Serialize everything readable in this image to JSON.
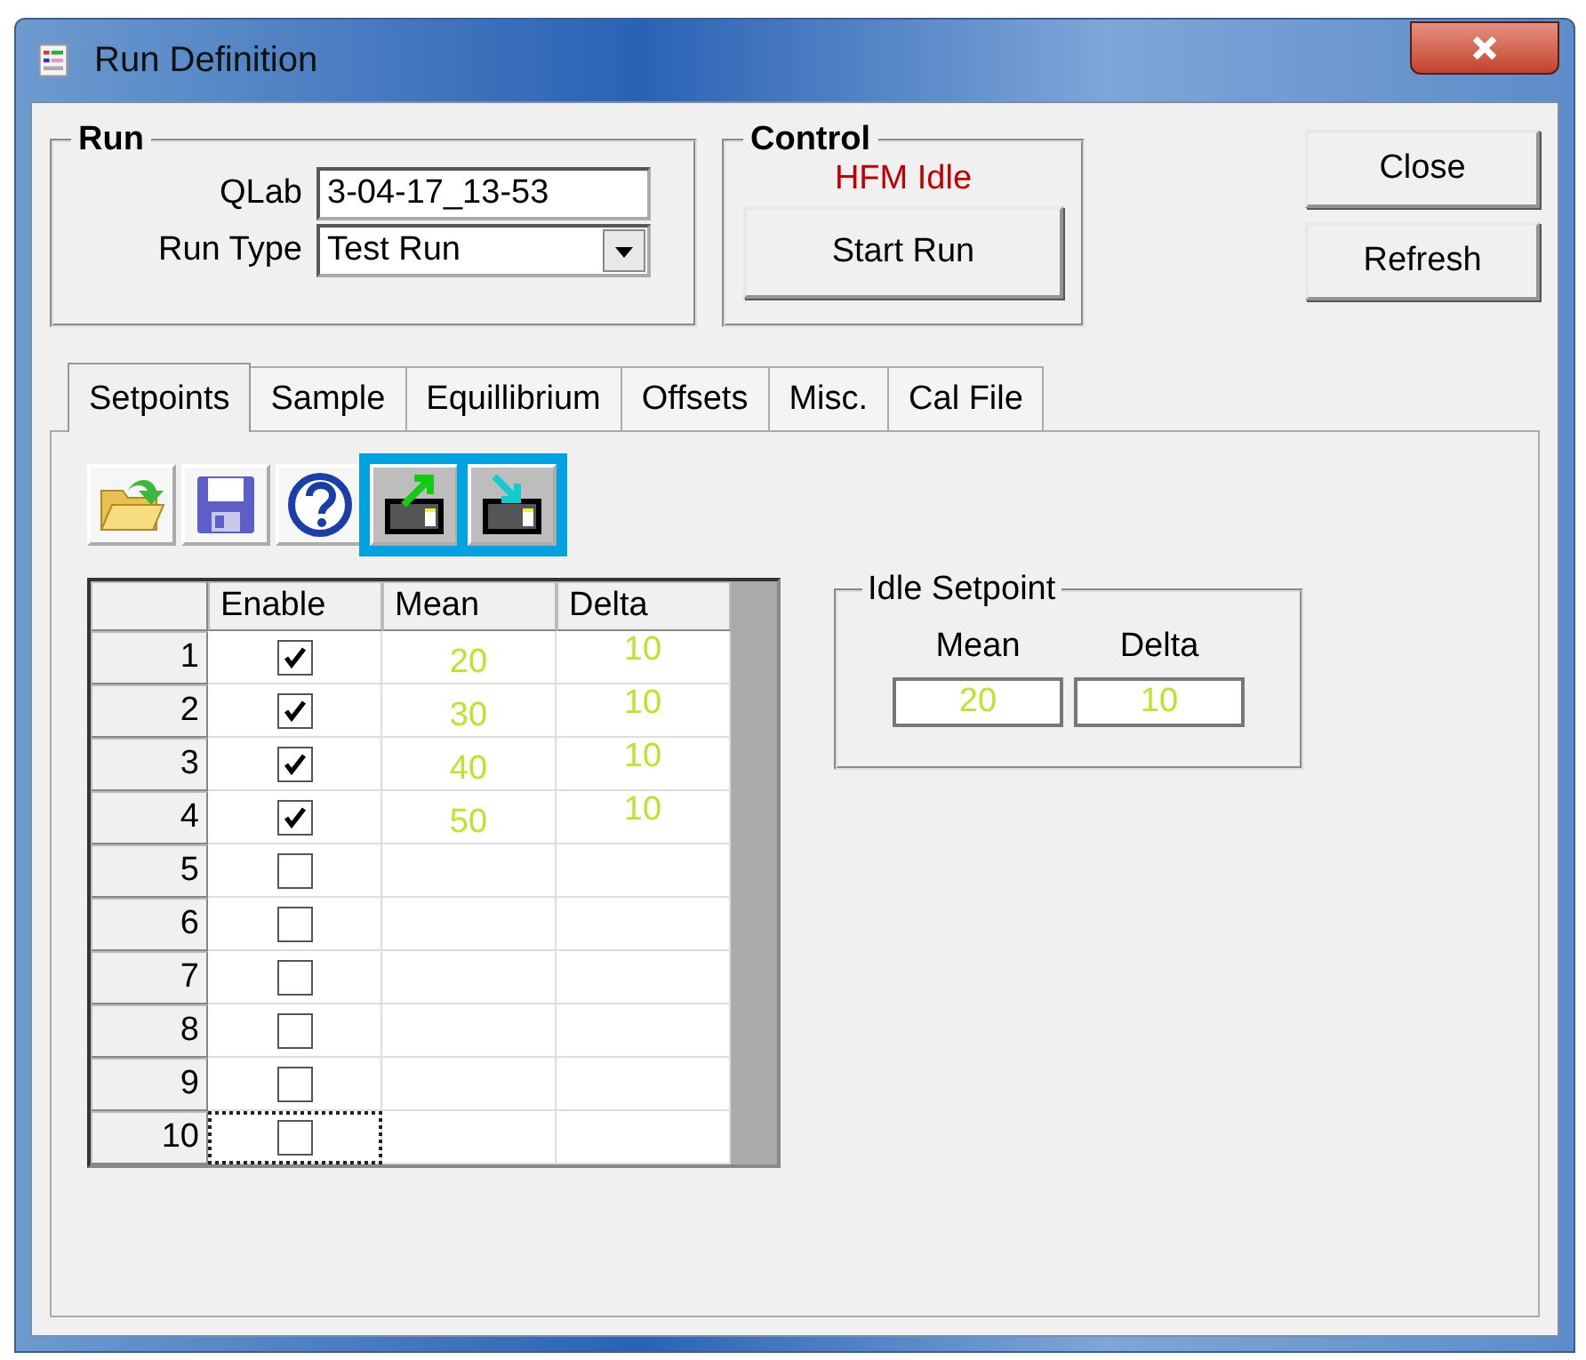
{
  "window": {
    "title": "Run Definition"
  },
  "run_group": {
    "title": "Run",
    "qlab_label": "QLab",
    "qlab_value": "3-04-17_13-53",
    "run_type_label": "Run Type",
    "run_type_value": "Test Run"
  },
  "control_group": {
    "title": "Control",
    "status": "HFM Idle",
    "start_button": "Start Run"
  },
  "side_buttons": [
    "Close",
    "Refresh"
  ],
  "tabs": [
    {
      "label": "Setpoints",
      "selected": true
    },
    {
      "label": "Sample",
      "selected": false
    },
    {
      "label": "Equillibrium",
      "selected": false
    },
    {
      "label": "Offsets",
      "selected": false
    },
    {
      "label": "Misc.",
      "selected": false
    },
    {
      "label": "Cal File",
      "selected": false
    }
  ],
  "toolbar": [
    {
      "kind": "open",
      "highlighted": false
    },
    {
      "kind": "save",
      "highlighted": false
    },
    {
      "kind": "help",
      "highlighted": false
    },
    {
      "kind": "export",
      "highlighted": true
    },
    {
      "kind": "import",
      "highlighted": true
    }
  ],
  "grid": {
    "columns": [
      "Enable",
      "Mean",
      "Delta"
    ],
    "rows": [
      {
        "number": "1",
        "enabled": true,
        "mean": "20",
        "delta": "10",
        "focused": false
      },
      {
        "number": "2",
        "enabled": true,
        "mean": "30",
        "delta": "10",
        "focused": false
      },
      {
        "number": "3",
        "enabled": true,
        "mean": "40",
        "delta": "10",
        "focused": false
      },
      {
        "number": "4",
        "enabled": true,
        "mean": "50",
        "delta": "10",
        "focused": false
      },
      {
        "number": "5",
        "enabled": false,
        "focused": false
      },
      {
        "number": "6",
        "enabled": false,
        "focused": false
      },
      {
        "number": "7",
        "enabled": false,
        "focused": false
      },
      {
        "number": "8",
        "enabled": false,
        "focused": false
      },
      {
        "number": "9",
        "enabled": false,
        "focused": false
      },
      {
        "number": "10",
        "enabled": false,
        "focused": true
      }
    ]
  },
  "idle_setpoint": {
    "title": "Idle Setpoint",
    "mean_label": "Mean",
    "mean_value": "20",
    "delta_label": "Delta",
    "delta_value": "10"
  }
}
